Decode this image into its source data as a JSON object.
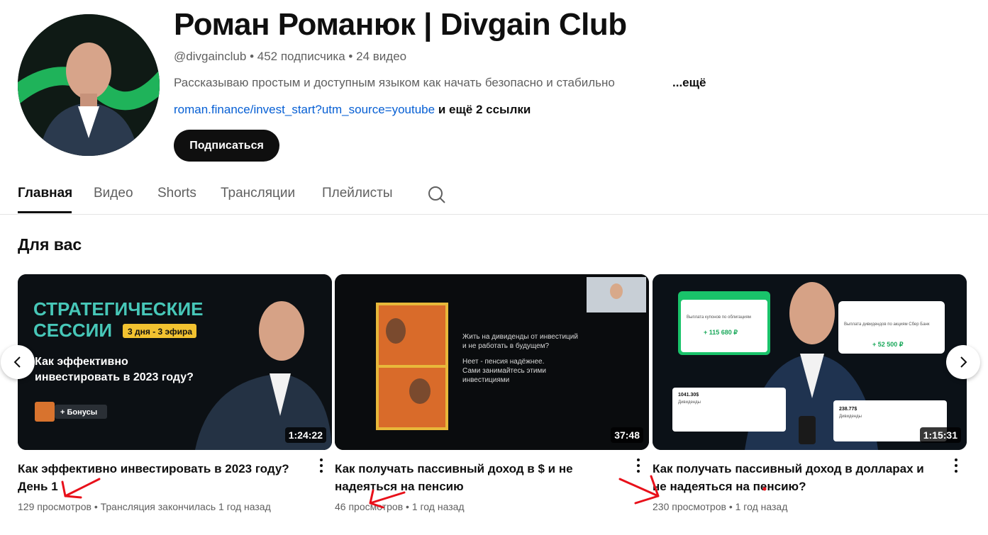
{
  "channel": {
    "name": "Роман Романюк | Divgain Club",
    "handle": "@divgainclub",
    "subscribers": "452 подписчика",
    "videos": "24 видео",
    "separator": "•",
    "description": "Рассказываю простым и доступным языком как начать безопасно и стабильно",
    "description_more": "...ещё",
    "link": "roman.finance/invest_start?utm_source=youtube",
    "more_links": "и ещё 2 ссылки",
    "subscribe_label": "Подписаться"
  },
  "tabs": [
    {
      "label": "Главная",
      "active": true
    },
    {
      "label": "Видео",
      "active": false
    },
    {
      "label": "Shorts",
      "active": false
    },
    {
      "label": "Трансляции",
      "active": false
    },
    {
      "label": "Плейлисты",
      "active": false
    }
  ],
  "section_title": "Для вас",
  "videos": [
    {
      "title": "Как эффективно инвестировать в 2023 году? День 1",
      "views": "129 просмотров",
      "extra": "Трансляция закончилась 1 год назад",
      "duration": "1:24:22",
      "thumb_text": {
        "line1": "СТРАТЕГИЧЕСКИЕ",
        "line2": "СЕССИИ",
        "badge": "3 дня - 3 эфира",
        "q1": "Как эффективно",
        "q2": "инвестировать в 2023 году?",
        "bonus": "+ Бонусы"
      }
    },
    {
      "title": "Как получать пассивный доход в $ и не надеяться на пенсию",
      "views": "46 просмотров",
      "extra": "1 год назад",
      "duration": "37:48",
      "thumb_text": {
        "q1": "Жить на дивиденды от инвестиций",
        "q2": "и не работать в будущем?",
        "a1": "Неет - пенсия надёжнее.",
        "a2": "Сами занимайтесь этими",
        "a3": "инвестициями"
      }
    },
    {
      "title": "Как получать пассивный доход в долларах и не надеяться на пенсию?",
      "views": "230 просмотров",
      "extra": "1 год назад",
      "duration": "1:15:31",
      "thumb_text": {
        "amount1": "+ 115 680 ₽",
        "amount2": "+ 52 500 ₽",
        "receipt1": "1041.30$",
        "receipt2": "238.77$",
        "div_label": "Дивиденды",
        "card2_title": "Выплата дивидендов по акциям Сбер Банк",
        "card1_title": "Выплата купонов по облигациям"
      }
    }
  ],
  "colors": {
    "accent_link": "#065fd4",
    "annotation": "#e8101a",
    "thumb_teal": "#47c7b8",
    "thumb_green": "#19c36a"
  },
  "icons": [
    "search-icon",
    "chevron-left-icon",
    "chevron-right-icon",
    "more-vert-icon"
  ]
}
